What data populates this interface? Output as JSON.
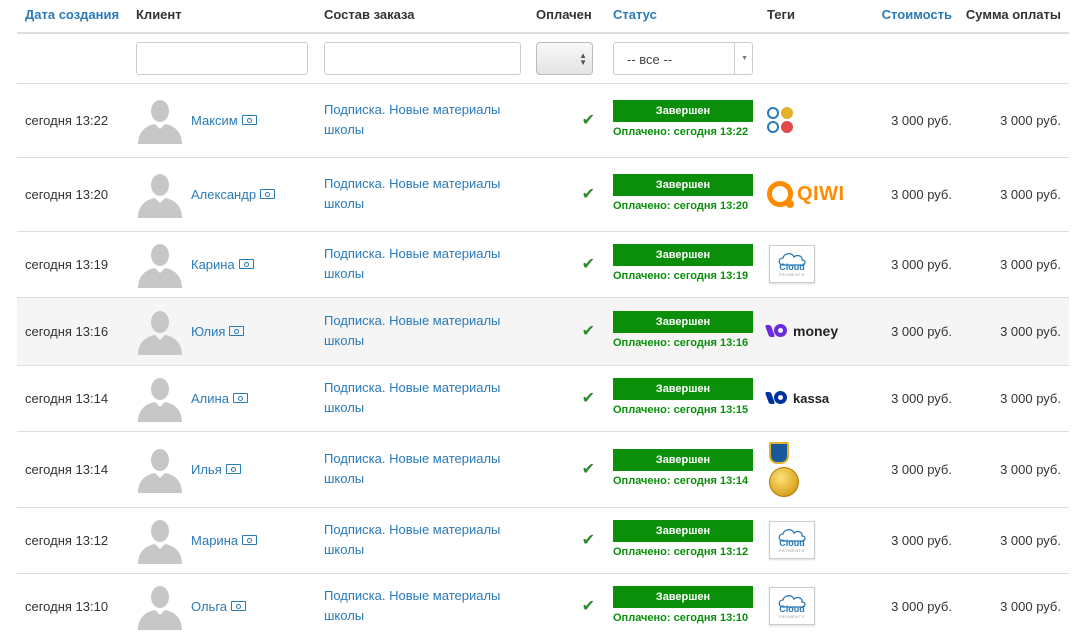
{
  "headers": {
    "date": "Дата создания",
    "client": "Клиент",
    "order": "Состав заказа",
    "paid": "Оплачен",
    "status": "Статус",
    "tags": "Теги",
    "price": "Стоимость",
    "sum": "Сумма оплаты"
  },
  "filters": {
    "status_selected": "-- все --"
  },
  "rows": [
    {
      "date": "сегодня 13:22",
      "client": "Максим",
      "order": "Подписка. Новые материалы школы",
      "paid_icon": "check-icon",
      "status": "Завершен",
      "paid_text": "Оплачено: сегодня 13:22",
      "tag": "multi-payment-icon",
      "price": "3 000 руб.",
      "sum": "3 000 руб."
    },
    {
      "date": "сегодня 13:20",
      "client": "Александр",
      "order": "Подписка. Новые материалы школы",
      "paid_icon": "check-icon",
      "status": "Завершен",
      "paid_text": "Оплачено: сегодня 13:20",
      "tag": "qiwi-logo",
      "tag_text": "QIWI",
      "price": "3 000 руб.",
      "sum": "3 000 руб."
    },
    {
      "date": "сегодня 13:19",
      "client": "Карина",
      "order": "Подписка. Новые материалы школы",
      "paid_icon": "check-icon",
      "status": "Завершен",
      "paid_text": "Оплачено: сегодня 13:19",
      "tag": "cloudpayments-logo",
      "tag_text": "Cloud",
      "price": "3 000 руб.",
      "sum": "3 000 руб."
    },
    {
      "date": "сегодня 13:16",
      "client": "Юлия",
      "order": "Подписка. Новые материалы школы",
      "paid_icon": "check-icon",
      "status": "Завершен",
      "paid_text": "Оплачено: сегодня 13:16",
      "tag": "yoomoney-logo",
      "tag_text": "money",
      "price": "3 000 руб.",
      "sum": "3 000 руб."
    },
    {
      "date": "сегодня 13:14",
      "client": "Алина",
      "order": "Подписка. Новые материалы школы",
      "paid_icon": "check-icon",
      "status": "Завершен",
      "paid_text": "Оплачено: сегодня 13:15",
      "tag": "yookassa-logo",
      "tag_text": "kassa",
      "price": "3 000 руб.",
      "sum": "3 000 руб."
    },
    {
      "date": "сегодня 13:14",
      "client": "Илья",
      "order": "Подписка. Новые материалы школы",
      "paid_icon": "check-icon",
      "status": "Завершен",
      "paid_text": "Оплачено: сегодня 13:14",
      "tag": "robokassa-coins-logo",
      "price": "3 000 руб.",
      "sum": "3 000 руб."
    },
    {
      "date": "сегодня 13:12",
      "client": "Марина",
      "order": "Подписка. Новые материалы школы",
      "paid_icon": "check-icon",
      "status": "Завершен",
      "paid_text": "Оплачено: сегодня 13:12",
      "tag": "cloudpayments-logo",
      "tag_text": "Cloud",
      "price": "3 000 руб.",
      "sum": "3 000 руб."
    },
    {
      "date": "сегодня 13:10",
      "client": "Ольга",
      "order": "Подписка. Новые материалы школы",
      "paid_icon": "check-icon",
      "status": "Завершен",
      "paid_text": "Оплачено: сегодня 13:10",
      "tag": "cloudpayments-logo",
      "tag_text": "Cloud",
      "price": "3 000 руб.",
      "sum": "3 000 руб."
    }
  ],
  "colors": {
    "link": "#2a7ab8",
    "status_green": "#0b8f0b",
    "row_highlight": "#f5f5f5"
  }
}
